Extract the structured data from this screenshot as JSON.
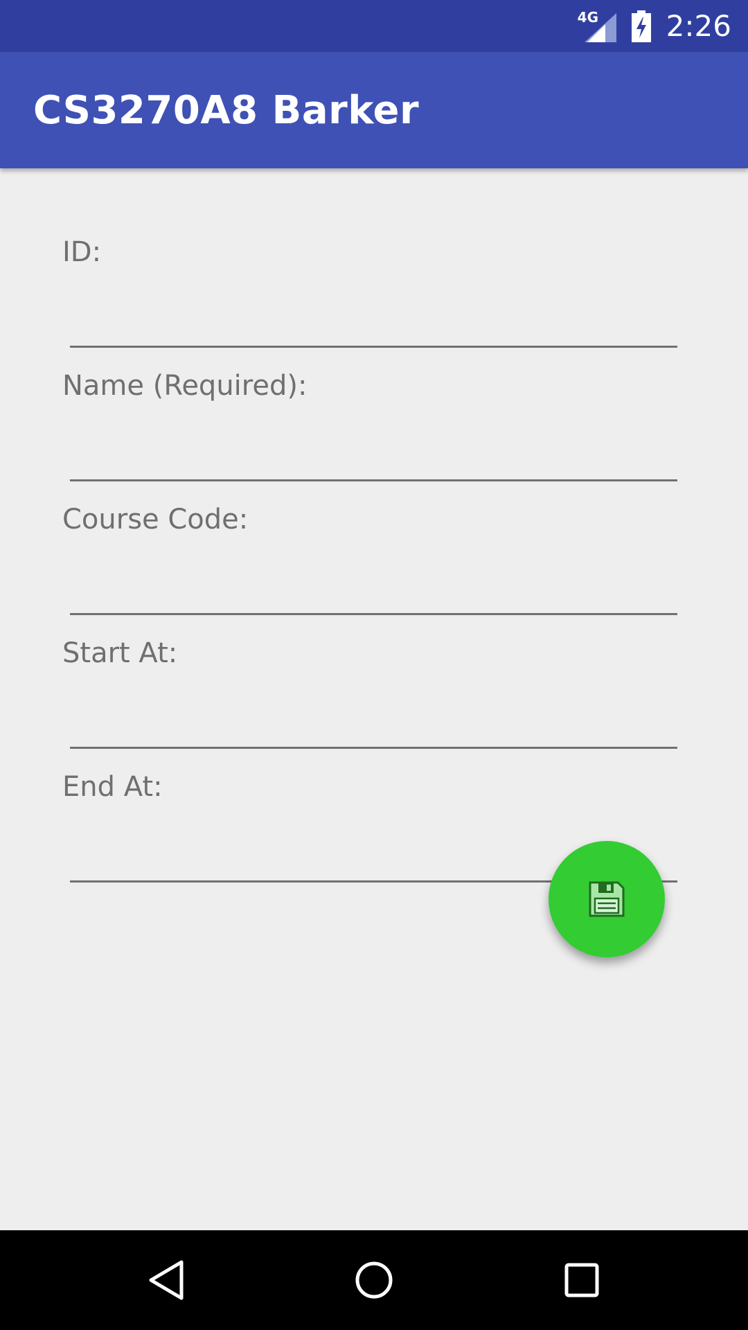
{
  "status_bar": {
    "network_type": "4G",
    "time": "2:26",
    "icons": [
      "signal-icon",
      "battery-charging-icon"
    ]
  },
  "app_bar": {
    "title": "CS3270A8 Barker"
  },
  "form": {
    "fields": [
      {
        "label": "ID:",
        "value": ""
      },
      {
        "label": "Name (Required):",
        "value": ""
      },
      {
        "label": "Course Code:",
        "value": ""
      },
      {
        "label": "Start At:",
        "value": ""
      },
      {
        "label": "End At:",
        "value": ""
      }
    ]
  },
  "fab": {
    "icon": "save-icon",
    "color": "#33cc33"
  },
  "navigation_bar": {
    "buttons": [
      "back-icon",
      "home-icon",
      "recents-icon"
    ]
  },
  "colors": {
    "status_bar": "#303f9f",
    "app_bar": "#3f51b5",
    "background": "#eeeeee"
  }
}
